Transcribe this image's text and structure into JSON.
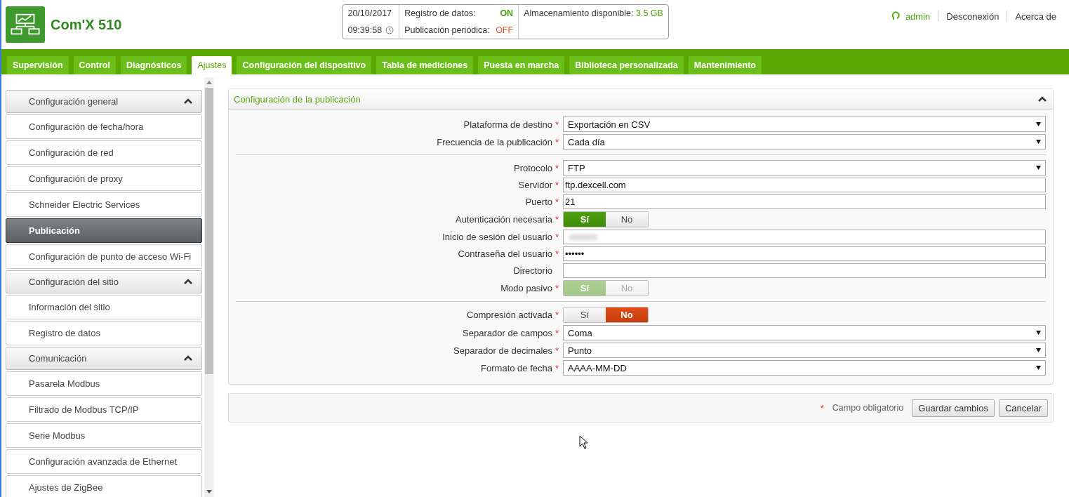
{
  "app": {
    "title": "Com'X 510"
  },
  "status": {
    "date": "20/10/2017",
    "time": "09:39:58",
    "logging_label": "Registro de datos:",
    "logging_value": "ON",
    "logging_on": true,
    "publish_label": "Publicación periódica:",
    "publish_value": "OFF",
    "publish_on": false,
    "storage_label": "Almacenamiento disponible:",
    "storage_value": "3.5 GB"
  },
  "user_links": [
    {
      "label": "admin",
      "kind": "user"
    },
    {
      "label": "Desconexión",
      "kind": "link"
    },
    {
      "label": "Acerca de",
      "kind": "link"
    }
  ],
  "tabs": [
    {
      "label": "Supervisión",
      "selected": false
    },
    {
      "label": "Control",
      "selected": false
    },
    {
      "label": "Diagnósticos",
      "selected": false
    },
    {
      "label": "Ajustes",
      "selected": true
    },
    {
      "label": "Configuración del dispositivo",
      "selected": false
    },
    {
      "label": "Tabla de mediciones",
      "selected": false
    },
    {
      "label": "Puesta en marcha",
      "selected": false
    },
    {
      "label": "Biblioteca personalizada",
      "selected": false
    },
    {
      "label": "Mantenimiento",
      "selected": false
    }
  ],
  "sidebar": {
    "groups": [
      {
        "label": "Configuración general",
        "expanded": true,
        "items": [
          {
            "label": "Configuración de fecha/hora",
            "selected": false
          },
          {
            "label": "Configuración de red",
            "selected": false
          },
          {
            "label": "Configuración de proxy",
            "selected": false
          },
          {
            "label": "Schneider Electric Services",
            "selected": false
          },
          {
            "label": "Publicación",
            "selected": true
          },
          {
            "label": "Configuración de punto de acceso Wi-Fi",
            "selected": false
          }
        ]
      },
      {
        "label": "Configuración del sitio",
        "expanded": true,
        "items": [
          {
            "label": "Información del sitio",
            "selected": false
          },
          {
            "label": "Registro de datos",
            "selected": false
          }
        ]
      },
      {
        "label": "Comunicación",
        "expanded": true,
        "items": [
          {
            "label": "Pasarela Modbus",
            "selected": false
          },
          {
            "label": "Filtrado de Modbus TCP/IP",
            "selected": false
          },
          {
            "label": "Serie Modbus",
            "selected": false
          },
          {
            "label": "Configuración avanzada de Ethernet",
            "selected": false
          },
          {
            "label": "Ajustes de ZigBee",
            "selected": false
          }
        ]
      }
    ]
  },
  "panel": {
    "title": "Configuración de la publicación",
    "expanded": true,
    "rows": [
      {
        "kind": "select",
        "label": "Plataforma de destino",
        "required": true,
        "value": "Exportación en CSV"
      },
      {
        "kind": "select",
        "label": "Frecuencia de la publicación",
        "required": true,
        "value": "Cada día"
      },
      {
        "kind": "separator"
      },
      {
        "kind": "select",
        "label": "Protocolo",
        "required": true,
        "value": "FTP"
      },
      {
        "kind": "text",
        "label": "Servidor",
        "required": true,
        "value": "ftp.dexcell.com"
      },
      {
        "kind": "text",
        "label": "Puerto",
        "required": true,
        "value": "21"
      },
      {
        "kind": "toggle",
        "label": "Autenticación necesaria",
        "required": true,
        "disabled": false,
        "options": [
          {
            "label": "Sí",
            "selected": true
          },
          {
            "label": "No",
            "selected": false
          }
        ]
      },
      {
        "kind": "text",
        "label": "Inicio de sesión del usuario",
        "required": true,
        "redacted": true
      },
      {
        "kind": "text",
        "label": "Contraseña del usuario",
        "required": true,
        "value": "••••••"
      },
      {
        "kind": "text",
        "label": "Directorio",
        "required": false
      },
      {
        "kind": "toggle",
        "label": "Modo pasivo",
        "required": true,
        "disabled": true,
        "options": [
          {
            "label": "Sí",
            "selected": true
          },
          {
            "label": "No",
            "selected": false
          }
        ]
      },
      {
        "kind": "separator"
      },
      {
        "kind": "toggle",
        "label": "Compresión activada",
        "required": true,
        "disabled": false,
        "options": [
          {
            "label": "Sí",
            "selected": false
          },
          {
            "label": "No",
            "selected": true
          }
        ]
      },
      {
        "kind": "select",
        "label": "Separador de campos",
        "required": true,
        "value": "Coma"
      },
      {
        "kind": "select",
        "label": "Separador de decimales",
        "required": true,
        "value": "Punto"
      },
      {
        "kind": "select",
        "label": "Formato de fecha",
        "required": true,
        "value": "AAAA-MM-DD"
      }
    ]
  },
  "footer": {
    "required_mark": "*",
    "required_note": "Campo obligatorio",
    "buttons": [
      "Guardar cambios",
      "Cancelar"
    ]
  }
}
